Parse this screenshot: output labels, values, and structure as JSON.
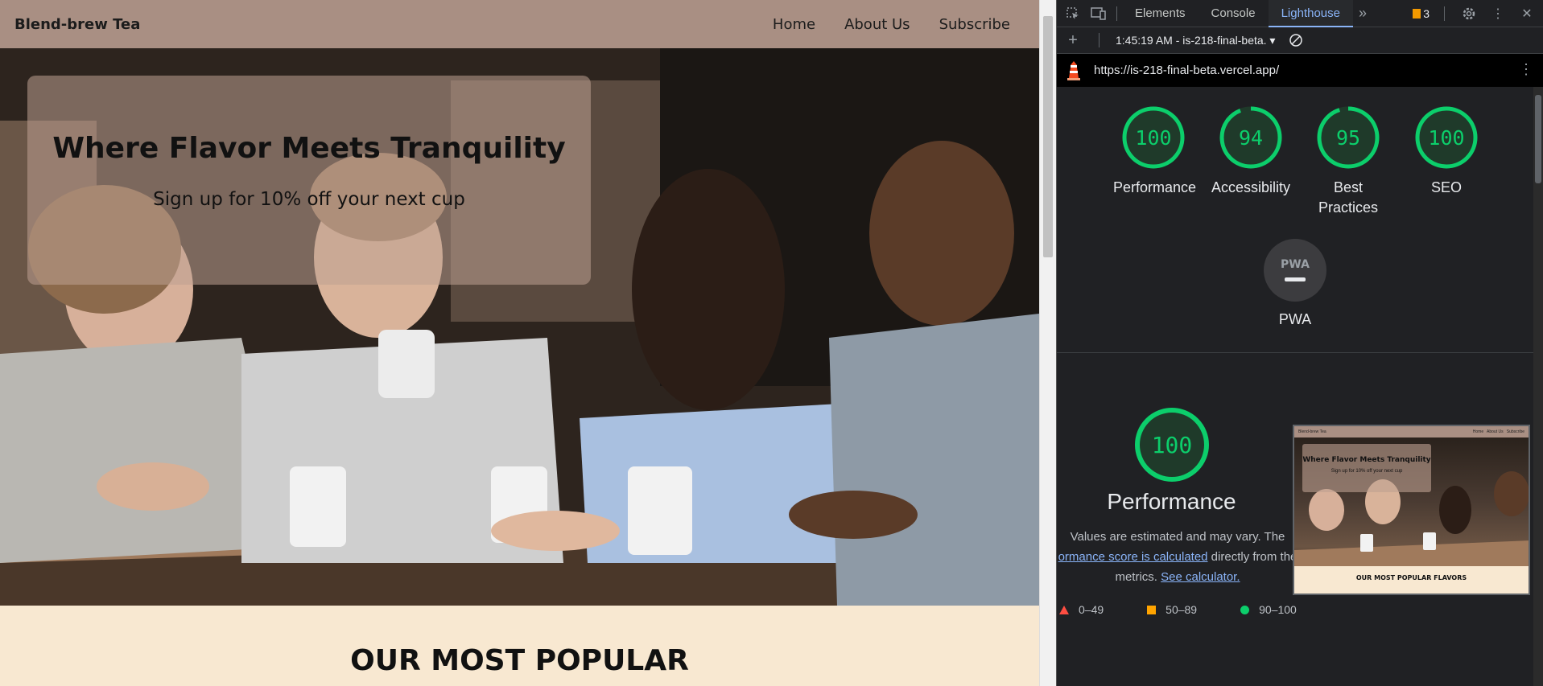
{
  "site": {
    "brand": "Blend-brew Tea",
    "nav": [
      "Home",
      "About Us",
      "Subscribe"
    ],
    "hero_title": "Where Flavor Meets Tranquility",
    "hero_subtitle": "Sign up for 10% off your next cup",
    "section_title": "OUR MOST POPULAR"
  },
  "devtools": {
    "tabs": [
      "Elements",
      "Console",
      "Lighthouse"
    ],
    "active_tab": "Lighthouse",
    "issues_count": "3",
    "report_select": "1:45:19 AM - is-218-final-beta.",
    "url": "https://is-218-final-beta.vercel.app/",
    "scores": [
      {
        "label": "Performance",
        "value": 100
      },
      {
        "label": "Accessibility",
        "value": 94
      },
      {
        "label": "Best Practices",
        "value": 95
      },
      {
        "label": "SEO",
        "value": 100
      }
    ],
    "pwa_label": "PWA",
    "pwa_badge": "PWA",
    "performance": {
      "score": 100,
      "title": "Performance",
      "desc_1": "Values are estimated and may vary. The",
      "desc_link_1": "ormance score is calculated",
      "desc_2": " directly from the",
      "desc_3": "metrics. ",
      "desc_link_2": "See calculator."
    },
    "thumbnail": {
      "brand": "Blend-brew Tea",
      "nav": [
        "Home",
        "About Us",
        "Subscribe"
      ],
      "title": "Where Flavor Meets Tranquility",
      "subtitle": "Sign up for 10% off your next cup",
      "section": "OUR MOST POPULAR FLAVORS"
    },
    "legend": [
      "0–49",
      "50–89",
      "90–100"
    ],
    "colors": {
      "pass": "#0cce6b",
      "average": "#ffa400",
      "fail": "#ff4e42",
      "link": "#8ab4f8"
    }
  }
}
